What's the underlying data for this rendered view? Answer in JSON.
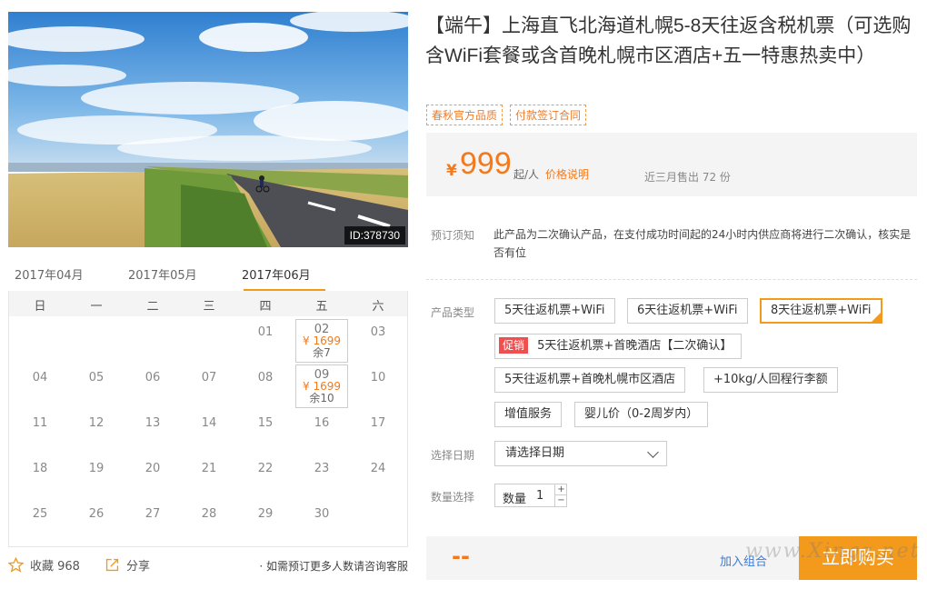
{
  "hero": {
    "id_label": "ID:378730"
  },
  "calendar": {
    "months": [
      "2017年04月",
      "2017年05月",
      "2017年06月"
    ],
    "weekdays": [
      "日",
      "一",
      "二",
      "三",
      "四",
      "五",
      "六"
    ],
    "rows": [
      [
        "",
        "",
        "",
        "",
        "01",
        "02",
        "03"
      ],
      [
        "04",
        "05",
        "06",
        "07",
        "08",
        "09",
        "10"
      ],
      [
        "11",
        "12",
        "13",
        "14",
        "15",
        "16",
        "17"
      ],
      [
        "18",
        "19",
        "20",
        "21",
        "22",
        "23",
        "24"
      ],
      [
        "25",
        "26",
        "27",
        "28",
        "29",
        "30",
        ""
      ]
    ],
    "avail_0602": {
      "day": "02",
      "price": "¥ 1699",
      "stock": "余7"
    },
    "avail_0609": {
      "day": "09",
      "price": "¥ 1699",
      "stock": "余10"
    }
  },
  "bottom": {
    "favorite": "收藏 968",
    "share": "分享",
    "note": "· 如需预订更多人数请咨询客服"
  },
  "product": {
    "title": "【端午】上海直飞北海道札幌5-8天往返含税机票（可选购含WiFi套餐或含首晚札幌市区酒店+五一特惠热卖中）",
    "tags": [
      "春秋官方品质",
      "付款签订合同"
    ],
    "price": {
      "currency": "¥",
      "amount": "999",
      "from": "起/人",
      "explain": "价格说明",
      "sold": "近三月售出 72 份"
    },
    "notice_label": "预订须知",
    "notice_text": "此产品为二次确认产品，在支付成功时间起的24小时内供应商将进行二次确认，核实是否有位",
    "type_label": "产品类型",
    "options": {
      "o1": "5天往返机票+WiFi",
      "o2": "6天往返机票+WiFi",
      "o3": "8天往返机票+WiFi",
      "o4_promo": "促销",
      "o4": "5天往返机票+首晚酒店【二次确认】",
      "o5": "5天往返机票+首晚札幌市区酒店",
      "o6": "+10kg/人回程行李额",
      "o7": "增值服务",
      "o8": "婴儿价（0-2周岁内）"
    },
    "date_label": "选择日期",
    "date_placeholder": "请选择日期",
    "qty_label": "数量选择",
    "qty_text": "数量",
    "qty_value": "1",
    "total": "--",
    "add_to_compare": "加入组合",
    "buy_now": "立即购买"
  },
  "colors": {
    "accent": "#f39a1c",
    "price": "#f37a1c",
    "promo": "#ef4f4f",
    "link": "#3b7bd6"
  },
  "watermark": "www.Xingz.net"
}
